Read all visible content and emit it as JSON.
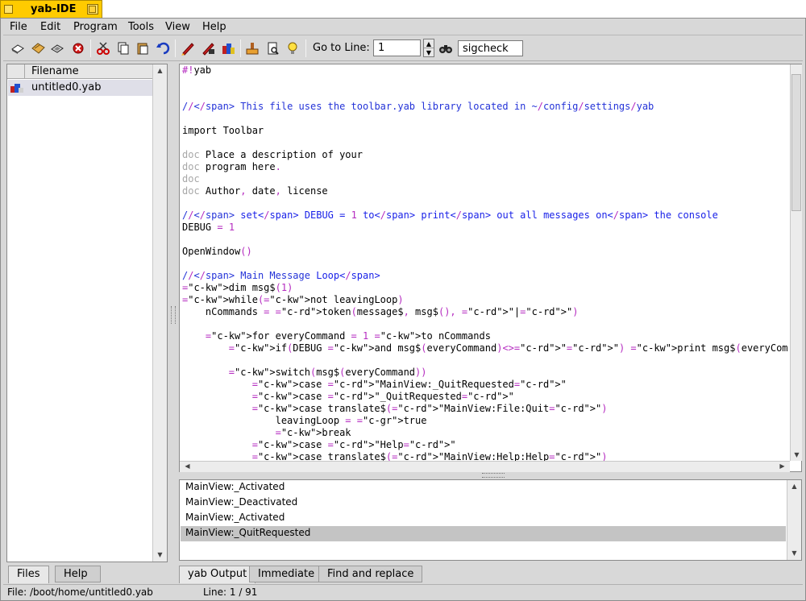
{
  "window": {
    "title": "yab-IDE"
  },
  "menu": [
    "File",
    "Edit",
    "Program",
    "Tools",
    "View",
    "Help"
  ],
  "toolbar": {
    "buttons": [
      "new-icon",
      "open-icon",
      "save-icon",
      "close-icon",
      "cut-icon",
      "copy-icon",
      "paste-icon",
      "undo-icon",
      "run-icon",
      "run-terminal-icon",
      "build-icon",
      "pattern-editor-icon",
      "help-icon",
      "tips-icon"
    ],
    "goto_label": "Go to Line:",
    "goto_value": "1",
    "find_value": "sigcheck"
  },
  "file_list": {
    "header": "Filename",
    "files": [
      {
        "name": "untitled0.yab"
      }
    ]
  },
  "left_tabs": [
    "Files",
    "Help"
  ],
  "editor": {
    "lines": [
      "#!yab",
      "",
      "",
      "// This file uses the toolbar.yab library located in ~/config/settings/yab",
      "",
      "import Toolbar",
      "",
      "doc Place a description of your",
      "doc program here.",
      "doc",
      "doc Author, date, license",
      "",
      "// set DEBUG = 1 to print out all messages on the console",
      "DEBUG = 1",
      "",
      "OpenWindow()",
      "",
      "// Main Message Loop",
      "dim msg$(1)",
      "while(not leavingLoop)",
      "    nCommands = token(message$, msg$(), \"|\")",
      "",
      "    for everyCommand = 1 to nCommands",
      "        if(DEBUG and msg$(everyCommand)<>\"\") print msg$(everyCommand)",
      "",
      "        switch(msg$(everyCommand))",
      "            case \"MainView:_QuitRequested\"",
      "            case \"_QuitRequested\"",
      "            case translate$(\"MainView:File:Quit\")",
      "                leavingLoop = true",
      "                break",
      "            case \"Help\"",
      "            case translate$(\"MainView:Help:Help\")"
    ]
  },
  "output": {
    "lines": [
      "MainView:_Activated",
      "MainView:_Deactivated",
      "MainView:_Activated",
      "MainView:_QuitRequested"
    ],
    "selected_index": 3
  },
  "output_tabs": [
    "yab Output",
    "Immediate",
    "Find and replace"
  ],
  "status": {
    "file": "File: /boot/home/untitled0.yab",
    "line": "Line: 1 / 91"
  }
}
